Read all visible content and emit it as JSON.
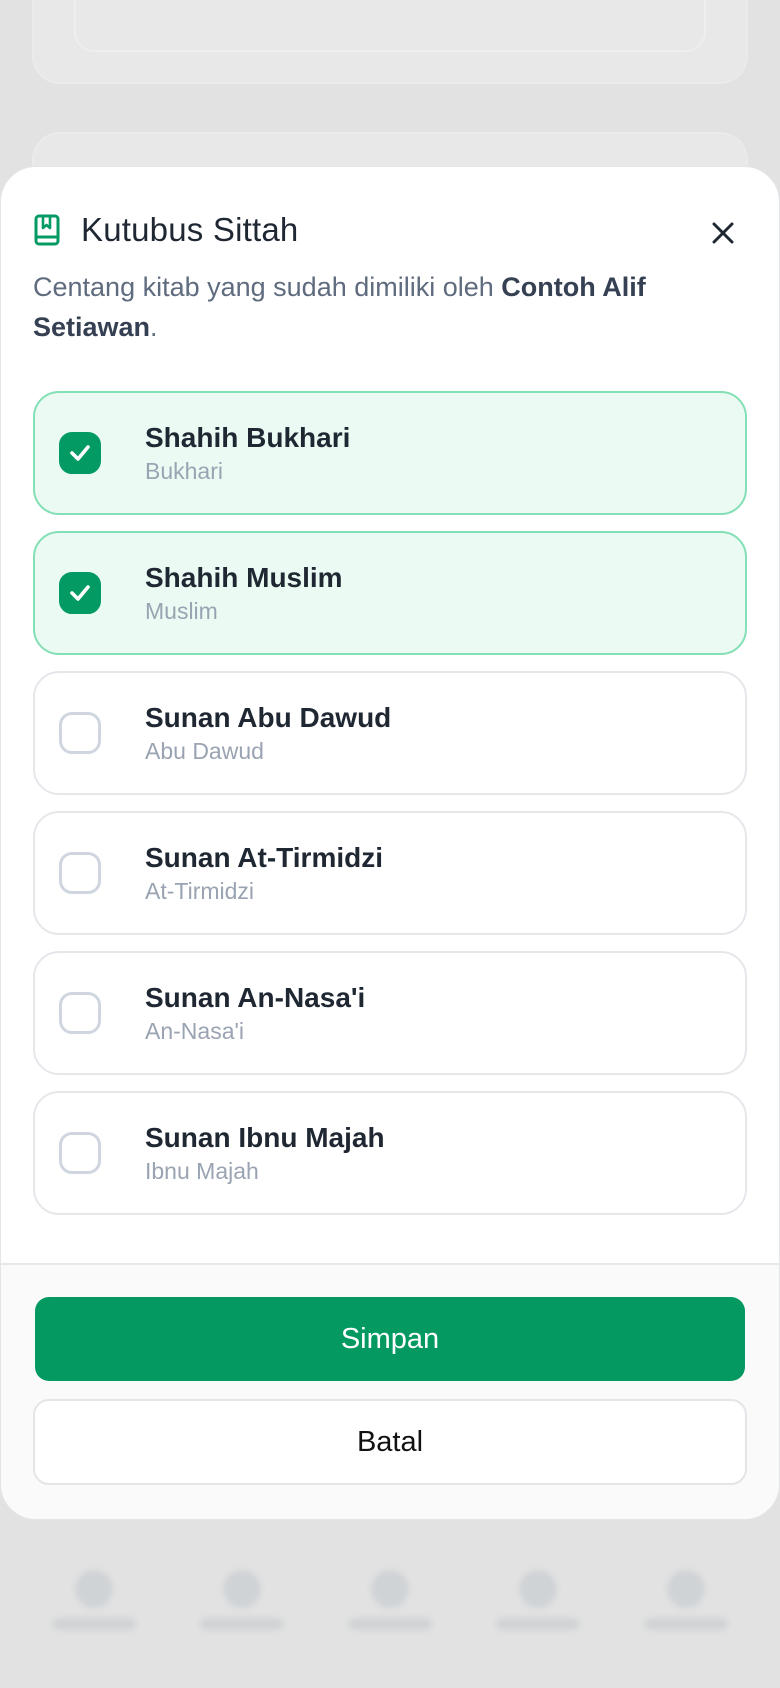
{
  "sheet": {
    "title": "Kutubus Sittah",
    "description_prefix": "Centang kitab yang sudah dimiliki oleh ",
    "owner_name": "Contoh Alif Setiawan",
    "description_suffix": "."
  },
  "books": [
    {
      "name": "Shahih Bukhari",
      "sub": "Bukhari",
      "checked": true
    },
    {
      "name": "Shahih Muslim",
      "sub": "Muslim",
      "checked": true
    },
    {
      "name": "Sunan Abu Dawud",
      "sub": "Abu Dawud",
      "checked": false
    },
    {
      "name": "Sunan At-Tirmidzi",
      "sub": "At-Tirmidzi",
      "checked": false
    },
    {
      "name": "Sunan An-Nasa'i",
      "sub": "An-Nasa'i",
      "checked": false
    },
    {
      "name": "Sunan Ibnu Majah",
      "sub": "Ibnu Majah",
      "checked": false
    }
  ],
  "actions": {
    "save_label": "Simpan",
    "cancel_label": "Batal"
  },
  "colors": {
    "accent": "#039961",
    "checked_bg": "#ebfbf3",
    "checked_border": "#83dfb5"
  },
  "icons": {
    "header": "book-icon",
    "close": "close-icon",
    "check": "check-icon"
  }
}
